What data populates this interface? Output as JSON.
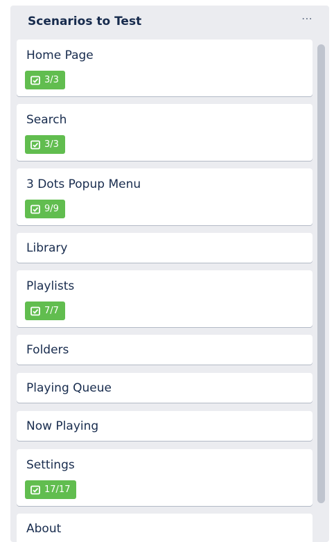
{
  "list": {
    "title": "Scenarios to Test",
    "menu_label": "⋯",
    "badge_color": "#61bd4f",
    "cards": [
      {
        "title": "Home Page",
        "checklist": "3/3"
      },
      {
        "title": "Search",
        "checklist": "3/3"
      },
      {
        "title": "3 Dots Popup Menu",
        "checklist": "9/9"
      },
      {
        "title": "Library"
      },
      {
        "title": "Playlists",
        "checklist": "7/7"
      },
      {
        "title": "Folders"
      },
      {
        "title": "Playing Queue"
      },
      {
        "title": "Now Playing"
      },
      {
        "title": "Settings",
        "checklist": "17/17"
      },
      {
        "title": "About"
      }
    ]
  }
}
